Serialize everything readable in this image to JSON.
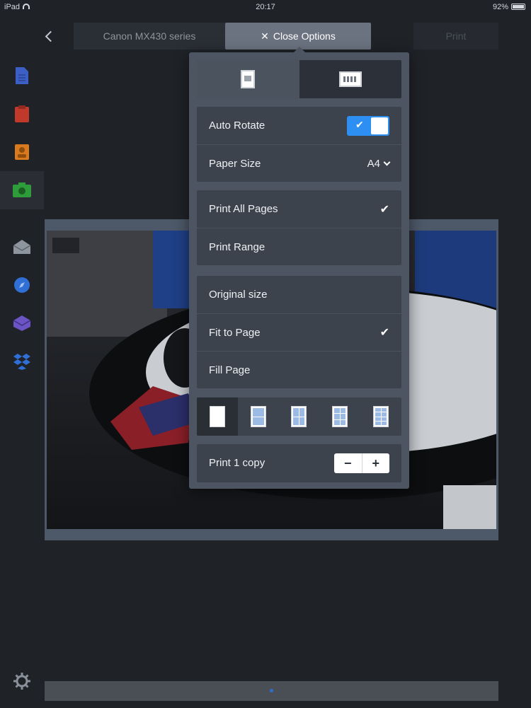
{
  "status_bar": {
    "device": "iPad",
    "time": "20:17",
    "battery": "92%"
  },
  "header": {
    "printer": "Canon MX430 series",
    "close_options": "Close Options",
    "print": "Print"
  },
  "sidebar": {
    "items": [
      {
        "icon": "document-icon",
        "color": "#3b5fc4"
      },
      {
        "icon": "clipboard-icon",
        "color": "#c0392b"
      },
      {
        "icon": "contacts-icon",
        "color": "#d97a1e"
      },
      {
        "icon": "photo-icon",
        "color": "#2e9c3a",
        "active": true
      },
      {
        "icon": "mail-icon",
        "color": "#8e959e"
      },
      {
        "icon": "compass-icon",
        "color": "#2f6fd6"
      },
      {
        "icon": "inbox-icon",
        "color": "#6b55c4"
      },
      {
        "icon": "dropbox-icon",
        "color": "#2f6fd6"
      }
    ],
    "settings_icon": "gear-icon"
  },
  "options": {
    "orientation": {
      "selected": "portrait"
    },
    "auto_rotate_label": "Auto Rotate",
    "auto_rotate_on": true,
    "paper_size_label": "Paper Size",
    "paper_size_value": "A4",
    "print_all_pages": "Print All Pages",
    "print_range": "Print Range",
    "original_size": "Original size",
    "fit_to_page": "Fit to Page",
    "fill_page": "Fill Page",
    "layouts": [
      "1-up",
      "2-up",
      "4-up",
      "6-up",
      "8-up"
    ],
    "copies_label": "Print 1 copy",
    "minus": "−",
    "plus": "+",
    "check": "✔"
  },
  "colors": {
    "accent": "#2d8ff2",
    "background": "#1f2227",
    "popover": "#4c5561"
  }
}
